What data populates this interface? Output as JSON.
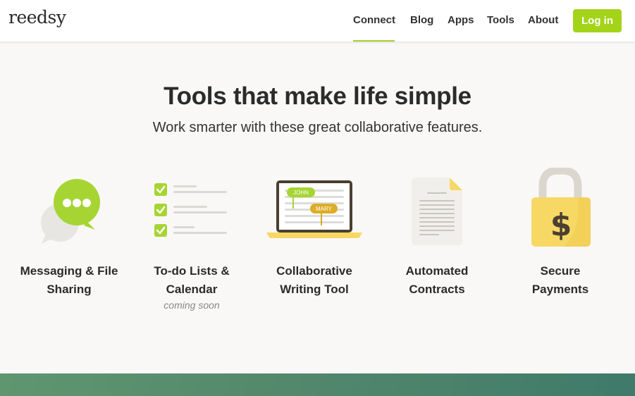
{
  "header": {
    "logo": "reedsy",
    "nav": [
      {
        "label": "Connect",
        "active": true
      },
      {
        "label": "Blog",
        "active": false
      },
      {
        "label": "Apps",
        "active": false
      },
      {
        "label": "Tools",
        "active": false
      },
      {
        "label": "About",
        "active": false
      }
    ],
    "login_label": "Log in"
  },
  "hero": {
    "title": "Tools that make life simple",
    "subtitle": "Work smarter with these great collaborative features."
  },
  "features": [
    {
      "icon": "chat-bubbles-icon",
      "line1": "Messaging & File",
      "line2": "Sharing",
      "note": ""
    },
    {
      "icon": "checklist-icon",
      "line1": "To-do Lists &",
      "line2": "Calendar",
      "note": "coming soon"
    },
    {
      "icon": "laptop-collab-icon",
      "line1": "Collaborative",
      "line2": "Writing Tool",
      "note": "",
      "tags": [
        "JOHN",
        "MARY"
      ]
    },
    {
      "icon": "document-icon",
      "line1": "Automated",
      "line2": "Contracts",
      "note": ""
    },
    {
      "icon": "padlock-dollar-icon",
      "line1": "Secure",
      "line2": "Payments",
      "note": "",
      "symbol": "$"
    }
  ],
  "colors": {
    "accent_green": "#a3d41a",
    "accent_yellow": "#f7d864",
    "band_start": "#5f9670",
    "band_end": "#3f7a6a"
  }
}
